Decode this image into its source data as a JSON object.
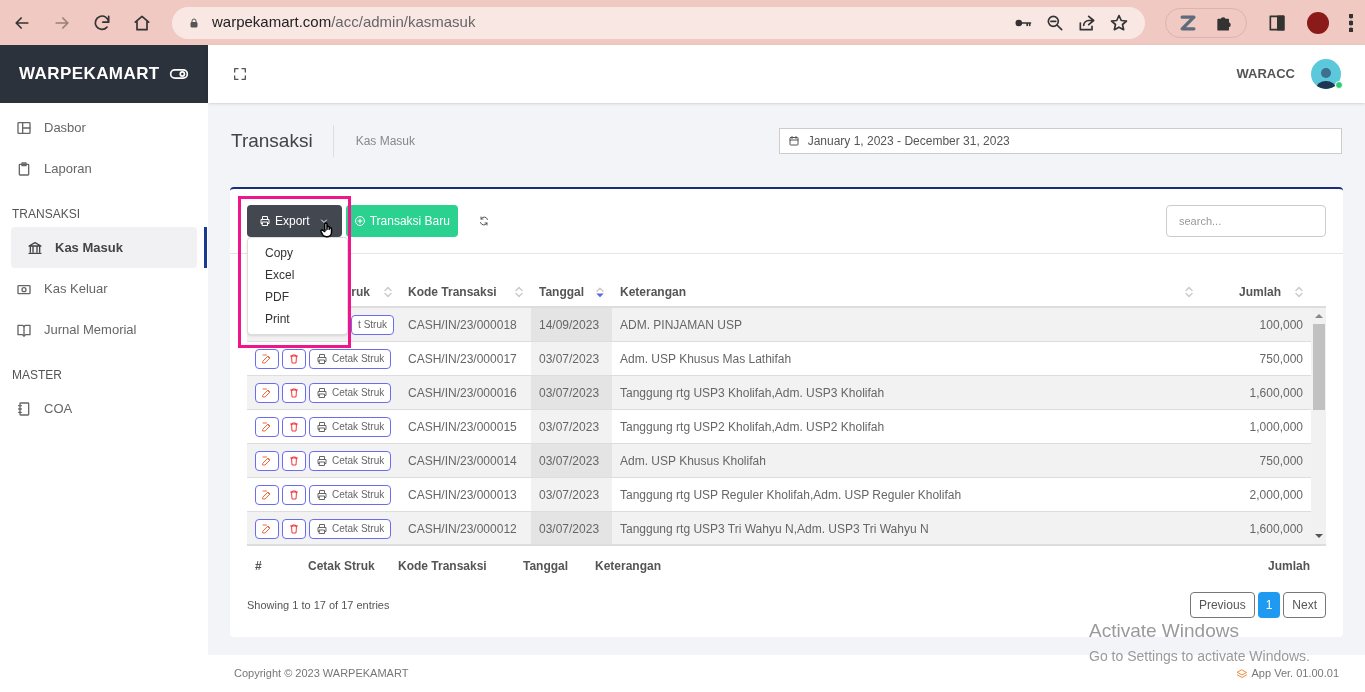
{
  "browser": {
    "url_host": "warpekamart.com",
    "url_path": "/acc/admin/kasmasuk"
  },
  "sidebar": {
    "brand": "WARPEKAMART",
    "sections": [
      {
        "items": [
          {
            "label": "Dasbor",
            "selected": false
          },
          {
            "label": "Laporan",
            "selected": false
          }
        ]
      },
      {
        "title": "TRANSAKSI",
        "items": [
          {
            "label": "Kas Masuk",
            "selected": true
          },
          {
            "label": "Kas Keluar",
            "selected": false
          },
          {
            "label": "Jurnal Memorial",
            "selected": false
          }
        ]
      },
      {
        "title": "MASTER",
        "items": [
          {
            "label": "COA",
            "selected": false
          }
        ]
      }
    ]
  },
  "header": {
    "user": "WARACC",
    "online": true
  },
  "page": {
    "title": "Transaksi",
    "breadcrumb": "Kas Masuk",
    "date_range": "January 1, 2023 - December 31, 2023"
  },
  "toolbar": {
    "export_label": "Export",
    "export_menu": [
      "Copy",
      "Excel",
      "PDF",
      "Print"
    ],
    "new_label": "Transaksi Baru",
    "search_placeholder": "search..."
  },
  "table": {
    "columns": [
      {
        "label": "ruk",
        "sorted": false
      },
      {
        "label": "Kode Transaksi",
        "sorted": false
      },
      {
        "label": "Tanggal",
        "sorted": true
      },
      {
        "label": "Keterangan",
        "sorted": false
      },
      {
        "label": "Jumlah",
        "sorted": false
      }
    ],
    "rows": [
      {
        "actions_visible": false,
        "print_label": "t Struk",
        "code": "CASH/IN/23/000018",
        "date": "14/09/2023",
        "desc": "ADM. PINJAMAN USP",
        "amount": "100,000"
      },
      {
        "actions_visible": true,
        "print_label": "Cetak Struk",
        "code": "CASH/IN/23/000017",
        "date": "03/07/2023",
        "desc": "Adm. USP Khusus Mas Lathifah",
        "amount": "750,000"
      },
      {
        "actions_visible": true,
        "print_label": "Cetak Struk",
        "code": "CASH/IN/23/000016",
        "date": "03/07/2023",
        "desc": "Tanggung rtg USP3 Kholifah,Adm. USP3 Kholifah",
        "amount": "1,600,000"
      },
      {
        "actions_visible": true,
        "print_label": "Cetak Struk",
        "code": "CASH/IN/23/000015",
        "date": "03/07/2023",
        "desc": "Tanggung rtg USP2 Kholifah,Adm. USP2 Kholifah",
        "amount": "1,000,000"
      },
      {
        "actions_visible": true,
        "print_label": "Cetak Struk",
        "code": "CASH/IN/23/000014",
        "date": "03/07/2023",
        "desc": "Adm. USP Khusus Kholifah",
        "amount": "750,000"
      },
      {
        "actions_visible": true,
        "print_label": "Cetak Struk",
        "code": "CASH/IN/23/000013",
        "date": "03/07/2023",
        "desc": "Tanggung rtg USP Reguler Kholifah,Adm. USP Reguler Kholifah",
        "amount": "2,000,000"
      },
      {
        "actions_visible": true,
        "print_label": "Cetak Struk",
        "code": "CASH/IN/23/000012",
        "date": "03/07/2023",
        "desc": "Tanggung rtg USP3 Tri Wahyu N,Adm. USP3 Tri Wahyu N",
        "amount": "1,600,000"
      }
    ],
    "footer_columns": [
      "#",
      "Cetak Struk",
      "Kode Transaksi",
      "Tanggal",
      "Keterangan",
      "Jumlah"
    ],
    "info": "Showing 1 to 17 of 17 entries",
    "pagination": [
      {
        "label": "Previous",
        "selected": false
      },
      {
        "label": "1",
        "selected": true
      },
      {
        "label": "Next",
        "selected": false
      }
    ]
  },
  "footer": {
    "copyright": "Copyright © 2023 WARPEKAMART",
    "version": "App Ver. 01.00.01"
  },
  "os_notice": {
    "title": "Activate Windows",
    "subtitle": "Go to Settings to activate Windows."
  }
}
